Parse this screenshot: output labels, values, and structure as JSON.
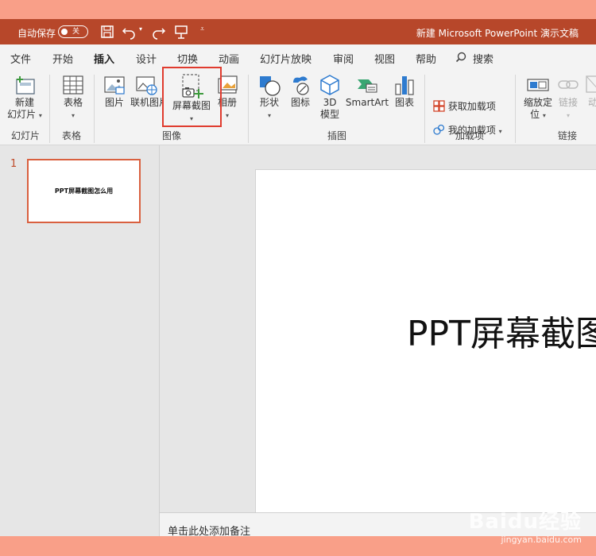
{
  "titlebar": {
    "autosave_label": "自动保存",
    "autosave_state": "关",
    "doc_title": "新建 Microsoft PowerPoint 演示文稿"
  },
  "tabs": [
    "文件",
    "开始",
    "插入",
    "设计",
    "切换",
    "动画",
    "幻灯片放映",
    "审阅",
    "视图",
    "帮助",
    "搜索"
  ],
  "active_tab": "插入",
  "ribbon": {
    "new_slide": "新建\n幻灯片",
    "table": "表格",
    "picture": "图片",
    "online_picture": "联机图片",
    "screenshot": "屏幕截图",
    "album": "相册",
    "shapes": "形状",
    "icons": "图标",
    "model3d": "3D\n模型",
    "smartart": "SmartArt",
    "chart": "图表",
    "get_addins": "获取加载项",
    "my_addins": "我的加载项",
    "zoom": "缩放定\n位",
    "link": "链接",
    "action": "动"
  },
  "groups": [
    "幻灯片",
    "表格",
    "图像",
    "插图",
    "加载项",
    "链接"
  ],
  "slides": {
    "number": "1",
    "thumb_title": "PPT屏幕截图怎么用"
  },
  "slide": {
    "title": "PPT屏幕截图怎么用"
  },
  "notes_placeholder": "单击此处添加备注",
  "watermark": {
    "logo": "Baidu经验",
    "url": "jingyan.baidu.com"
  },
  "colors": {
    "accent": "#b7472a",
    "highlight": "#e03b2e"
  }
}
